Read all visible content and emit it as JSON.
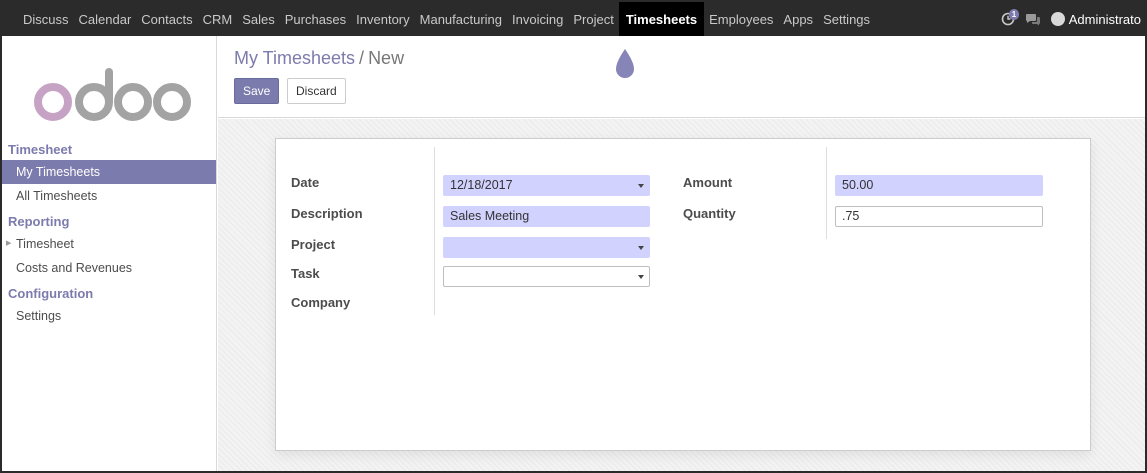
{
  "topnav": {
    "items": [
      "Discuss",
      "Calendar",
      "Contacts",
      "CRM",
      "Sales",
      "Purchases",
      "Inventory",
      "Manufacturing",
      "Invoicing",
      "Project",
      "Timesheets",
      "Employees",
      "Apps",
      "Settings"
    ],
    "active": "Timesheets",
    "activity_badge": "1",
    "user": "Administrato"
  },
  "sidebar": {
    "sections": [
      {
        "title": "Timesheet",
        "items": [
          {
            "label": "My Timesheets",
            "active": true
          },
          {
            "label": "All Timesheets"
          }
        ]
      },
      {
        "title": "Reporting",
        "items": [
          {
            "label": "Timesheet",
            "caret": true
          },
          {
            "label": "Costs and Revenues"
          }
        ]
      },
      {
        "title": "Configuration",
        "items": [
          {
            "label": "Settings"
          }
        ]
      }
    ]
  },
  "control": {
    "breadcrumb_parent": "My Timesheets",
    "breadcrumb_separator": "/",
    "breadcrumb_current": "New",
    "save_label": "Save",
    "discard_label": "Discard"
  },
  "form": {
    "labels": {
      "date": "Date",
      "description": "Description",
      "project": "Project",
      "task": "Task",
      "company": "Company",
      "amount": "Amount",
      "quantity": "Quantity"
    },
    "values": {
      "date": "12/18/2017",
      "description": "Sales Meeting",
      "project": "",
      "task": "",
      "company": "",
      "amount": "50.00",
      "quantity": ".75"
    }
  },
  "colors": {
    "brand": "#7c7bad",
    "navbar": "#2b2b2b",
    "required_field": "#d2d2ff"
  },
  "icons": [
    "odoo-logo",
    "chevron-down-icon",
    "activity-icon",
    "chat-icon",
    "avatar",
    "droplet-cursor-icon"
  ]
}
